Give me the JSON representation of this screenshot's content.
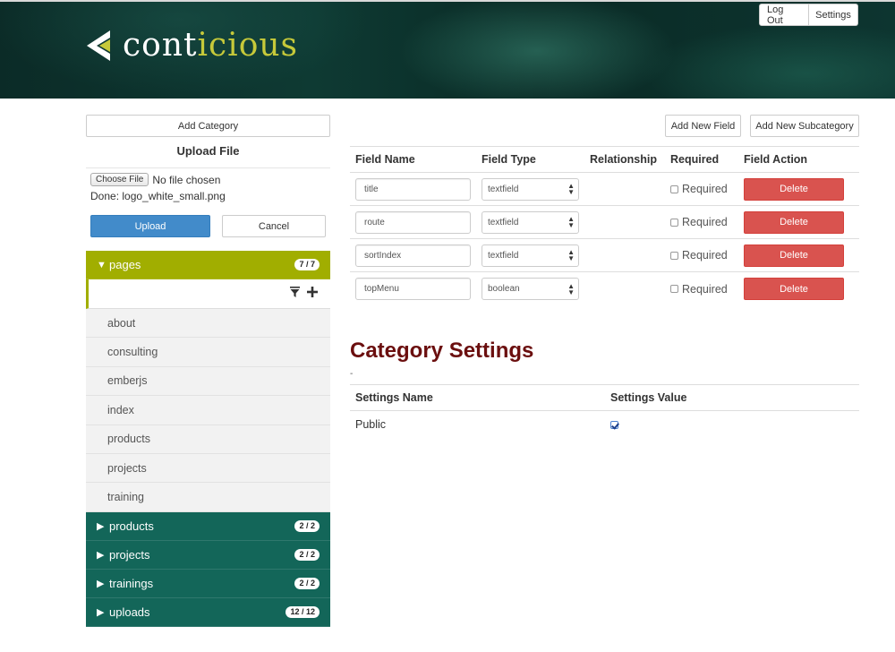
{
  "header": {
    "logo_icon": "chevron-logo-icon",
    "logo_text_a": "cont",
    "logo_text_b": "icious",
    "logout_label": "Log Out",
    "settings_label": "Settings",
    "accent": "#c6c93a"
  },
  "left": {
    "add_category_label": "Add Category",
    "upload_title": "Upload File",
    "choose_file_label": "Choose File",
    "no_file_text": "No file chosen",
    "done_text": "Done: logo_white_small.png",
    "upload_label": "Upload",
    "cancel_label": "Cancel",
    "groups": [
      {
        "label": "pages",
        "badge": "7 / 7",
        "open": true,
        "items": [
          "about",
          "consulting",
          "emberjs",
          "index",
          "products",
          "projects",
          "training"
        ]
      },
      {
        "label": "products",
        "badge": "2 / 2",
        "open": false
      },
      {
        "label": "projects",
        "badge": "2 / 2",
        "open": false
      },
      {
        "label": "trainings",
        "badge": "2 / 2",
        "open": false
      },
      {
        "label": "uploads",
        "badge": "12 / 12",
        "open": false
      }
    ],
    "colors": {
      "open_group": "#a1ae00",
      "closed_group": "#136659"
    }
  },
  "right": {
    "add_field_label": "Add New Field",
    "add_subcategory_label": "Add New Subcategory",
    "fields_headers": [
      "Field Name",
      "Field Type",
      "Relationship",
      "Required",
      "Field Action"
    ],
    "fields": [
      {
        "name": "title",
        "type": "textfield",
        "required_label": "Required",
        "action": "Delete"
      },
      {
        "name": "route",
        "type": "textfield",
        "required_label": "Required",
        "action": "Delete"
      },
      {
        "name": "sortIndex",
        "type": "textfield",
        "required_label": "Required",
        "action": "Delete"
      },
      {
        "name": "topMenu",
        "type": "boolean",
        "required_label": "Required",
        "action": "Delete"
      }
    ],
    "category_settings_title": "Category Settings",
    "category_settings_dash": "-",
    "settings_headers": [
      "Settings Name",
      "Settings Value"
    ],
    "settings": [
      {
        "name": "Public",
        "checked": true
      }
    ],
    "colors": {
      "delete": "#d9534f",
      "title": "#6b0f0f",
      "primary": "#428bca"
    }
  }
}
